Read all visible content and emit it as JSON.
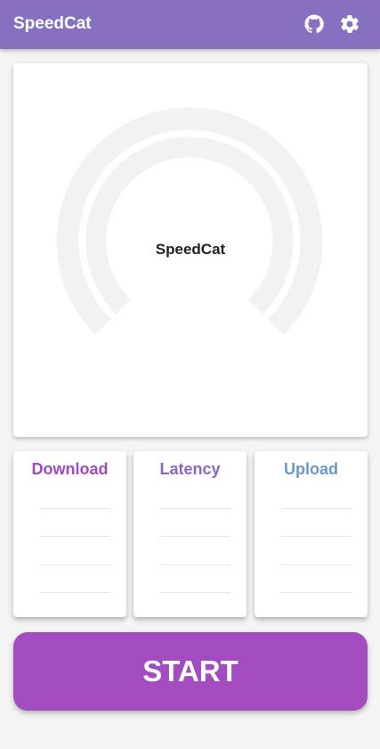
{
  "header": {
    "title": "SpeedCat",
    "icons": [
      "github-icon",
      "gear-icon"
    ]
  },
  "gauge": {
    "label": "SpeedCat",
    "track_color": "#f2f2f2"
  },
  "stats": [
    {
      "label": "Download",
      "color": "#a04cbf"
    },
    {
      "label": "Latency",
      "color": "#8a66c2"
    },
    {
      "label": "Upload",
      "color": "#6a98cc"
    }
  ],
  "start_button": {
    "label": "START",
    "color": "#a24cbf"
  },
  "colors": {
    "header": "#8870c0"
  }
}
